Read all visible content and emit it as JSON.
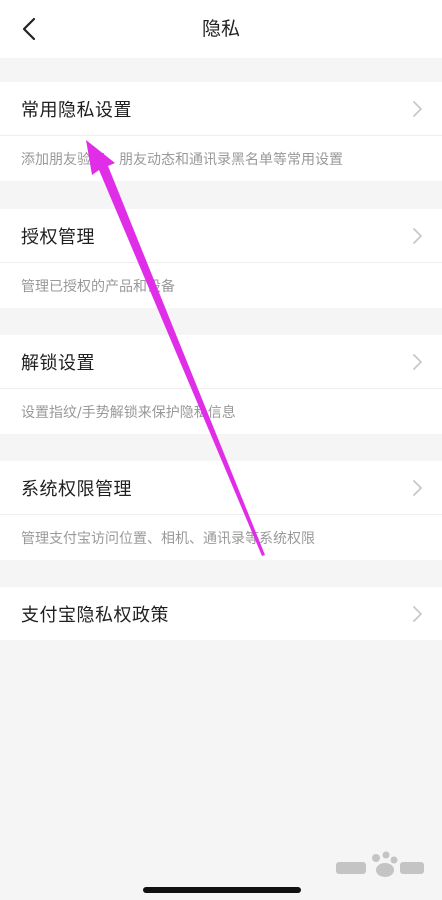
{
  "nav": {
    "title": "隐私"
  },
  "sections": [
    {
      "title": "常用隐私设置",
      "desc": "添加朋友验证、朋友动态和通讯录黑名单等常用设置"
    },
    {
      "title": "授权管理",
      "desc": "管理已授权的产品和设备"
    },
    {
      "title": "解锁设置",
      "desc": "设置指纹/手势解锁来保护隐私信息"
    },
    {
      "title": "系统权限管理",
      "desc": "管理支付宝访问位置、相机、通讯录等系统权限"
    },
    {
      "title": "支付宝隐私权政策"
    }
  ],
  "colors": {
    "accent_arrow": "#e02ee8",
    "background": "#f5f5f5"
  },
  "icons": {
    "back": "back-arrow-icon",
    "chevron": "chevron-right-icon"
  }
}
